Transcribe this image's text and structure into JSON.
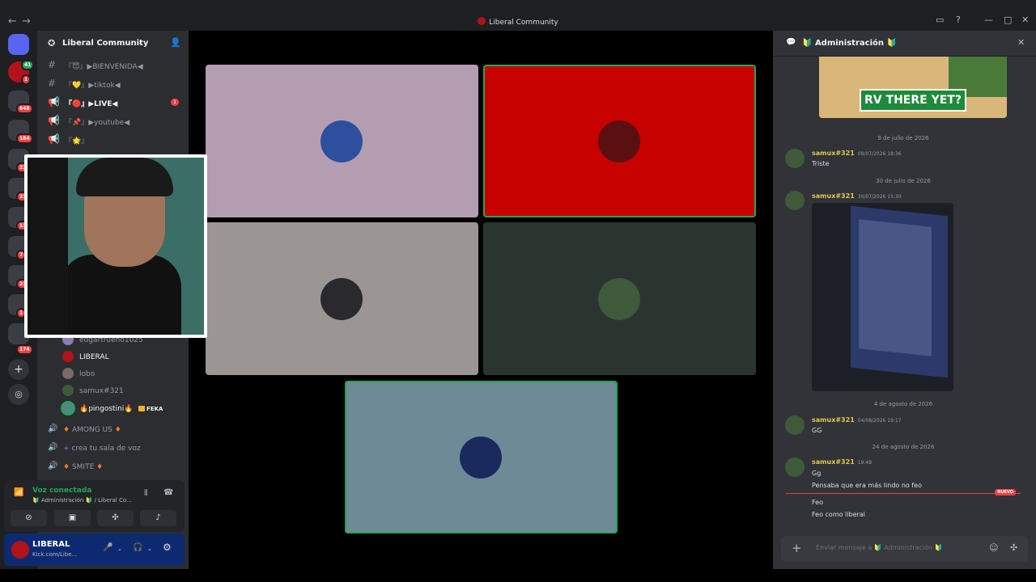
{
  "window": {
    "title": "Liberal Community"
  },
  "guilds": {
    "badges": [
      "41",
      "1",
      "648",
      "184",
      "21",
      "21",
      "13",
      "7",
      "21",
      "1",
      "174"
    ]
  },
  "sidebar": {
    "server_name": "Liberal Community",
    "channels": [
      {
        "emoji": "😇",
        "label": "▶BIENVENIDA◀"
      },
      {
        "emoji": "💛",
        "label": "▶tiktok◀"
      },
      {
        "emoji": "🔴",
        "label": "▶LIVE◀",
        "mention": "1"
      },
      {
        "emoji": "📌",
        "label": "▶youtube◀"
      },
      {
        "emoji": "🌟",
        "label": ""
      }
    ],
    "voice_members": [
      {
        "name": "edgartrueno1025"
      },
      {
        "name": "LIBERAL"
      },
      {
        "name": "lobo"
      },
      {
        "name": "samux#321"
      },
      {
        "name": "pingostini",
        "tag": "FEKA"
      }
    ],
    "voice_channels": [
      {
        "label": "AMONG US"
      },
      {
        "label": "crea tu sala de voz"
      },
      {
        "label": "SMITE"
      }
    ]
  },
  "voice_panel": {
    "status": "Voz conectada",
    "channel": "Administración",
    "server": "Liberal Co..."
  },
  "user": {
    "name": "LIBERAL",
    "status": "Kick.com/Libe..."
  },
  "chat": {
    "channel": "Administración",
    "banner_text": "RV THERE YET?",
    "messages": [
      {
        "date": "9 de julio de 2026",
        "author": "samux#321",
        "time": "09/07/2026 18:36",
        "lines": [
          "Triste"
        ]
      },
      {
        "date": "30 de julio de 2026",
        "author": "samux#321",
        "time": "30/07/2026 15:30",
        "lines": []
      },
      {
        "date": "4 de agosto de 2026",
        "author": "samux#321",
        "time": "04/08/2026 19:17",
        "lines": [
          "GG"
        ]
      },
      {
        "date": "24 de agosto de 2026",
        "author": "samux#321",
        "time": "19:48",
        "lines": [
          "Gg",
          "Pensaba que era más lindo no feo",
          "Feo",
          "Feo como liberal"
        ]
      }
    ],
    "new_label": "NUEVO",
    "composer_placeholder": "Enviar mensaje a 🔰 Administración 🔰"
  }
}
